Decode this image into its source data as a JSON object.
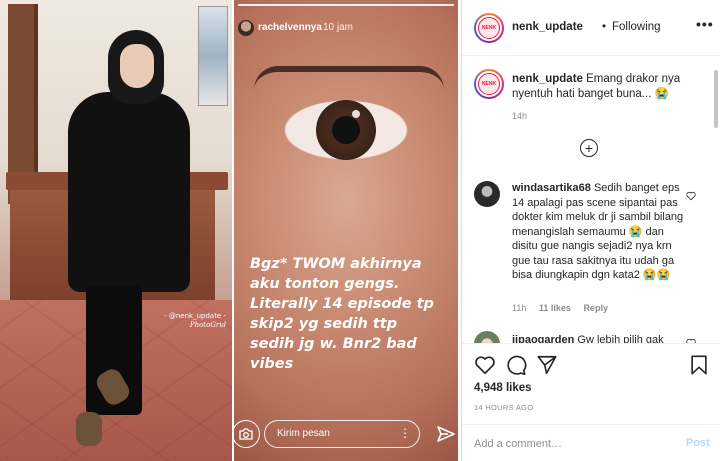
{
  "photo": {
    "watermark_line1": "- @nenk_update -",
    "watermark_line2": "PhotoGrid"
  },
  "story": {
    "username": "rachelvennya",
    "time": "10 jam",
    "caption": "Bgz* TWOM akhirnya\naku tonton gengs.\nLiterally 14 episode tp\nskip2 yg sedih ttp\nsedih jg w. Bnr2 bad\nvibes",
    "message_placeholder": "Kirim pesan",
    "icons": [
      "camera-icon",
      "more-vertical-icon",
      "send-icon"
    ]
  },
  "post": {
    "header": {
      "username": "nenk_update",
      "separator": "•",
      "follow_state": "Following",
      "more": "•••",
      "avatar_text": "NENK"
    },
    "caption": {
      "username": "nenk_update",
      "text": "Emang drakor nya nyentuh hati banget buna... 😭",
      "time": "14h"
    },
    "load_more": "+",
    "comments": [
      {
        "username": "windasartika68",
        "text": "Sedih banget eps 14 apalagi pas scene sipantai pas dokter kim meluk dr ji sambil bilang menangislah semaumu 😭 dan disitu gue nangis sejadi2 nya krn gue tau rasa sakitnya itu udah ga bisa diungkapin dgn kata2 😭😭",
        "time": "11h",
        "likes": "11 likes",
        "reply": "Reply"
      },
      {
        "username": "jipaogarden",
        "text": "Gw lebih pilih gak"
      }
    ],
    "likes": "4,948 likes",
    "timestamp": "14 HOURS AGO",
    "comment_placeholder": "Add a comment…",
    "post_button": "Post",
    "icons": [
      "heart-icon",
      "comment-icon",
      "share-icon",
      "bookmark-icon"
    ]
  },
  "colors": {
    "link_disabled": "#b3dbff",
    "muted": "#8e8e8e",
    "text": "#262626"
  }
}
